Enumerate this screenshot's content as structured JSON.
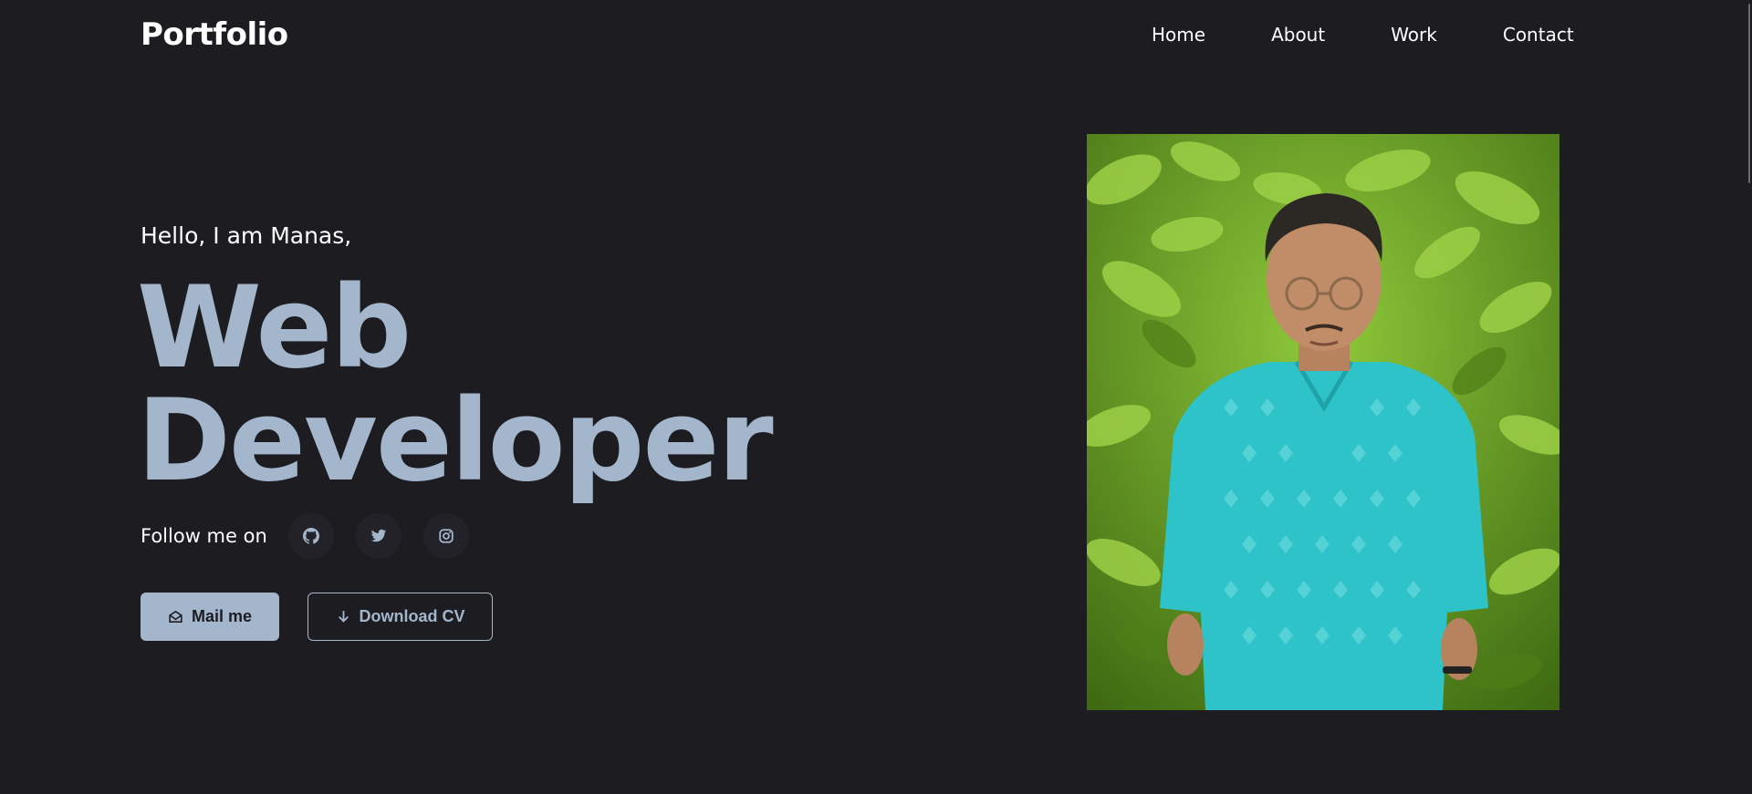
{
  "header": {
    "logo": "Portfolio",
    "nav": [
      "Home",
      "About",
      "Work",
      "Contact"
    ]
  },
  "hero": {
    "greeting": "Hello, I am Manas,",
    "title_line1": "Web",
    "title_line2": "Developer",
    "follow_label": "Follow me on",
    "socials": [
      "github-icon",
      "twitter-icon",
      "instagram-icon"
    ],
    "buttons": {
      "mail": "Mail me",
      "download": "Download CV"
    }
  },
  "colors": {
    "background": "#1c1c21",
    "accent": "#a3b6cb",
    "social_bg": "#232228"
  }
}
